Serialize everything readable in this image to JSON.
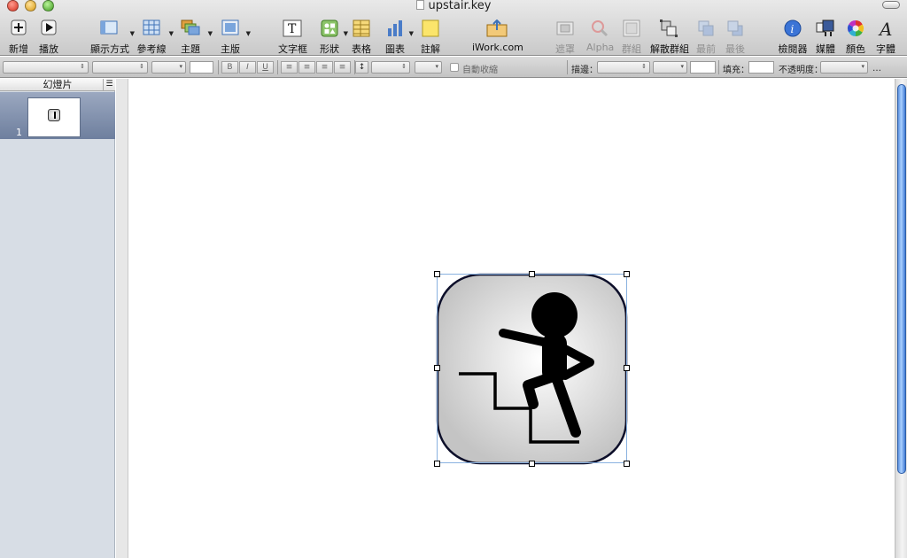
{
  "window": {
    "title": "upstair.key"
  },
  "toolbar": {
    "new": "新增",
    "play": "播放",
    "view": "顯示方式",
    "guides": "參考線",
    "themes": "主題",
    "masters": "主版",
    "text_box": "文字框",
    "shapes": "形狀",
    "table": "表格",
    "chart": "圖表",
    "comment": "註解",
    "iwork": "iWork.com",
    "mask": "遮罩",
    "alpha": "Alpha",
    "group": "群組",
    "ungroup": "解散群組",
    "front": "最前",
    "back": "最後",
    "inspector": "檢閱器",
    "media": "媒體",
    "colors": "顏色",
    "fonts": "字體"
  },
  "format_bar": {
    "autoshrink": "自動收縮",
    "stroke_label": "描邊：",
    "fill_label": "填充：",
    "opacity_label": "不透明度：",
    "bold": "B",
    "italic": "I",
    "underline": "U"
  },
  "navigator": {
    "header": "幻燈片",
    "slides": [
      {
        "number": "1"
      }
    ]
  },
  "colors": {
    "selection": "#7f9cc8",
    "scroll_thumb": "#5d92e0"
  }
}
